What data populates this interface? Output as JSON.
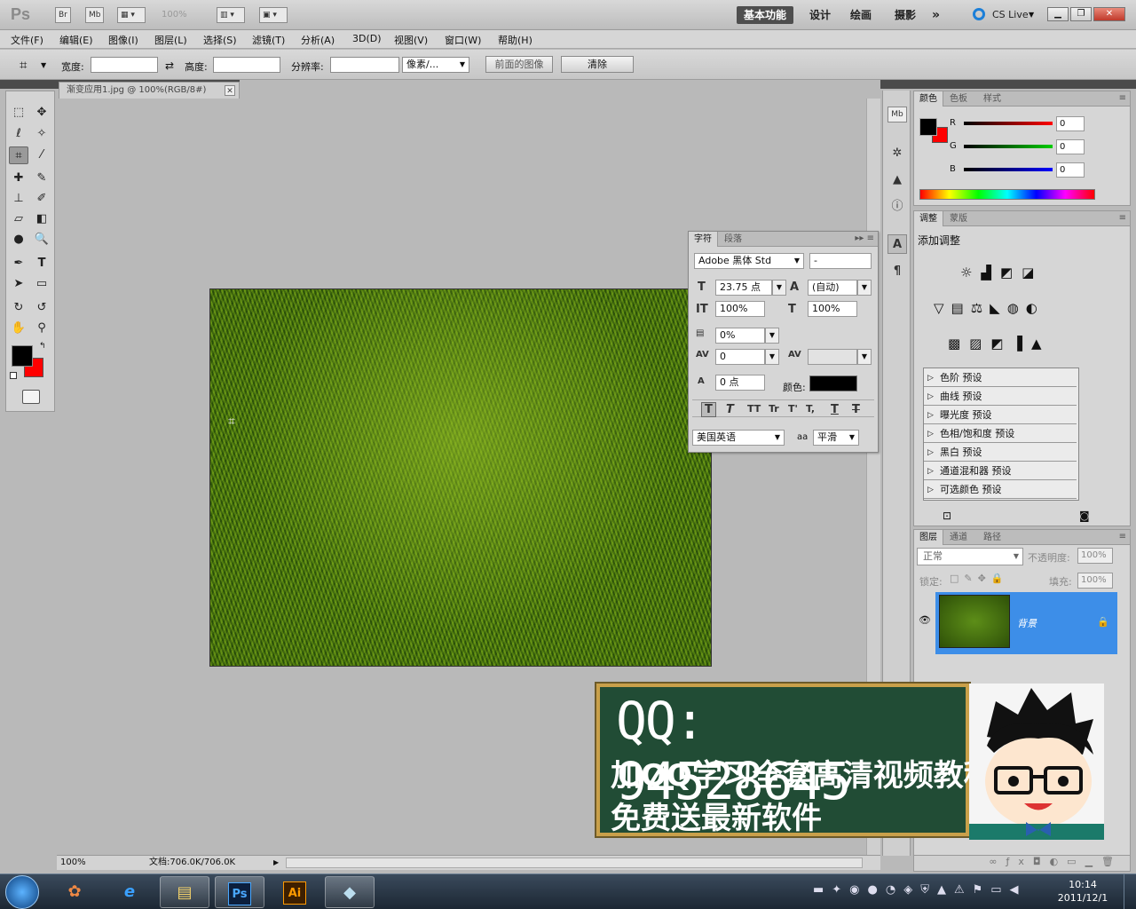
{
  "app": {
    "logo": "Ps",
    "bridge_label": "Br",
    "minibridge_label": "Mb",
    "zoom_level": "100%",
    "workspaces": [
      "基本功能",
      "设计",
      "绘画",
      "摄影"
    ],
    "more": "»",
    "cs_live": "CS Live",
    "window_buttons": [
      "▁",
      "❐",
      "✕"
    ]
  },
  "menu": [
    "文件(F)",
    "编辑(E)",
    "图像(I)",
    "图层(L)",
    "选择(S)",
    "滤镜(T)",
    "分析(A)",
    "3D(D)",
    "视图(V)",
    "窗口(W)",
    "帮助(H)"
  ],
  "options": {
    "width_label": "宽度:",
    "height_label": "高度:",
    "swap_icon": "⇄",
    "resolution_label": "分辨率:",
    "unit": "像素/...",
    "front_image": "前面的图像",
    "clear": "清除"
  },
  "document": {
    "tab_title": "渐变应用1.jpg @ 100%(RGB/8#)",
    "close": "✕",
    "status_zoom": "100%",
    "status_doc": "文档:706.0K/706.0K"
  },
  "color_panel": {
    "tabs": [
      "颜色",
      "色板",
      "样式"
    ],
    "channels": [
      {
        "label": "R",
        "value": "0",
        "color": "#d21f1f"
      },
      {
        "label": "G",
        "value": "0",
        "color": "#1fb21f"
      },
      {
        "label": "B",
        "value": "0",
        "color": "#2222cc"
      }
    ]
  },
  "adjust_panel": {
    "tabs": [
      "调整",
      "蒙版"
    ],
    "title": "添加调整",
    "presets": [
      "色阶 预设",
      "曲线 预设",
      "曝光度 预设",
      "色相/饱和度 预设",
      "黑白 预设",
      "通道混和器 预设",
      "可选颜色 预设"
    ]
  },
  "layers_panel": {
    "tabs": [
      "图层",
      "通道",
      "路径"
    ],
    "blend_mode": "正常",
    "opacity_label": "不透明度:",
    "opacity": "100%",
    "lock_label": "锁定:",
    "fill_label": "填充:",
    "fill": "100%",
    "layer_name": "背景"
  },
  "char_panel": {
    "tabs": [
      "字符",
      "段落"
    ],
    "font_family": "Adobe 黑体 Std",
    "font_style": "-",
    "size": "23.75 点",
    "leading": "(自动)",
    "v_scale": "100%",
    "h_scale": "100%",
    "tracking_pct": "0%",
    "kerning": "0",
    "baseline": "0 点",
    "color_label": "颜色:",
    "styles": [
      "T",
      "T",
      "TT",
      "Tr",
      "T'",
      "T,",
      "T",
      "T"
    ],
    "language": "美国英语",
    "aa_icon": "aa",
    "antialias": "平滑"
  },
  "banner": {
    "qq": "QQ: 94528645",
    "line2": "加QQ学习全套高清视频教程",
    "line3": "免费送最新软件"
  },
  "taskbar": {
    "time": "10:14",
    "date": "2011/12/1",
    "ps_label": "Ps",
    "ai_label": "Ai"
  },
  "colors": {
    "foreground": "#000000",
    "background": "#ff0000",
    "layer_highlight": "#3d8ee8"
  }
}
